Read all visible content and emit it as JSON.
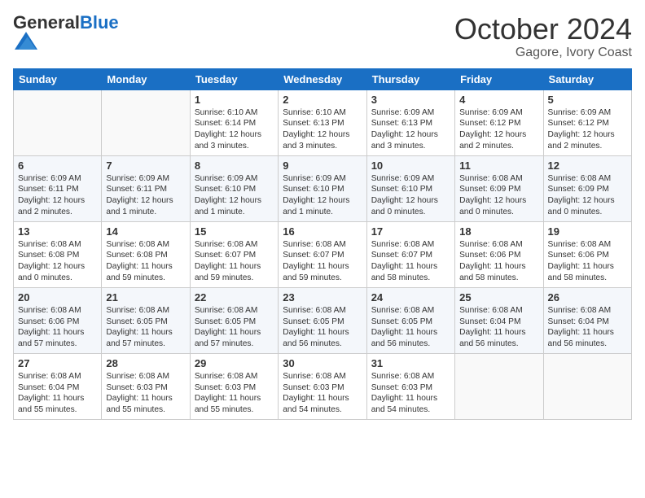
{
  "header": {
    "logo_general": "General",
    "logo_blue": "Blue",
    "month": "October 2024",
    "location": "Gagore, Ivory Coast"
  },
  "weekdays": [
    "Sunday",
    "Monday",
    "Tuesday",
    "Wednesday",
    "Thursday",
    "Friday",
    "Saturday"
  ],
  "weeks": [
    [
      {
        "day": "",
        "text": ""
      },
      {
        "day": "",
        "text": ""
      },
      {
        "day": "1",
        "text": "Sunrise: 6:10 AM\nSunset: 6:14 PM\nDaylight: 12 hours and 3 minutes."
      },
      {
        "day": "2",
        "text": "Sunrise: 6:10 AM\nSunset: 6:13 PM\nDaylight: 12 hours and 3 minutes."
      },
      {
        "day": "3",
        "text": "Sunrise: 6:09 AM\nSunset: 6:13 PM\nDaylight: 12 hours and 3 minutes."
      },
      {
        "day": "4",
        "text": "Sunrise: 6:09 AM\nSunset: 6:12 PM\nDaylight: 12 hours and 2 minutes."
      },
      {
        "day": "5",
        "text": "Sunrise: 6:09 AM\nSunset: 6:12 PM\nDaylight: 12 hours and 2 minutes."
      }
    ],
    [
      {
        "day": "6",
        "text": "Sunrise: 6:09 AM\nSunset: 6:11 PM\nDaylight: 12 hours and 2 minutes."
      },
      {
        "day": "7",
        "text": "Sunrise: 6:09 AM\nSunset: 6:11 PM\nDaylight: 12 hours and 1 minute."
      },
      {
        "day": "8",
        "text": "Sunrise: 6:09 AM\nSunset: 6:10 PM\nDaylight: 12 hours and 1 minute."
      },
      {
        "day": "9",
        "text": "Sunrise: 6:09 AM\nSunset: 6:10 PM\nDaylight: 12 hours and 1 minute."
      },
      {
        "day": "10",
        "text": "Sunrise: 6:09 AM\nSunset: 6:10 PM\nDaylight: 12 hours and 0 minutes."
      },
      {
        "day": "11",
        "text": "Sunrise: 6:08 AM\nSunset: 6:09 PM\nDaylight: 12 hours and 0 minutes."
      },
      {
        "day": "12",
        "text": "Sunrise: 6:08 AM\nSunset: 6:09 PM\nDaylight: 12 hours and 0 minutes."
      }
    ],
    [
      {
        "day": "13",
        "text": "Sunrise: 6:08 AM\nSunset: 6:08 PM\nDaylight: 12 hours and 0 minutes."
      },
      {
        "day": "14",
        "text": "Sunrise: 6:08 AM\nSunset: 6:08 PM\nDaylight: 11 hours and 59 minutes."
      },
      {
        "day": "15",
        "text": "Sunrise: 6:08 AM\nSunset: 6:07 PM\nDaylight: 11 hours and 59 minutes."
      },
      {
        "day": "16",
        "text": "Sunrise: 6:08 AM\nSunset: 6:07 PM\nDaylight: 11 hours and 59 minutes."
      },
      {
        "day": "17",
        "text": "Sunrise: 6:08 AM\nSunset: 6:07 PM\nDaylight: 11 hours and 58 minutes."
      },
      {
        "day": "18",
        "text": "Sunrise: 6:08 AM\nSunset: 6:06 PM\nDaylight: 11 hours and 58 minutes."
      },
      {
        "day": "19",
        "text": "Sunrise: 6:08 AM\nSunset: 6:06 PM\nDaylight: 11 hours and 58 minutes."
      }
    ],
    [
      {
        "day": "20",
        "text": "Sunrise: 6:08 AM\nSunset: 6:06 PM\nDaylight: 11 hours and 57 minutes."
      },
      {
        "day": "21",
        "text": "Sunrise: 6:08 AM\nSunset: 6:05 PM\nDaylight: 11 hours and 57 minutes."
      },
      {
        "day": "22",
        "text": "Sunrise: 6:08 AM\nSunset: 6:05 PM\nDaylight: 11 hours and 57 minutes."
      },
      {
        "day": "23",
        "text": "Sunrise: 6:08 AM\nSunset: 6:05 PM\nDaylight: 11 hours and 56 minutes."
      },
      {
        "day": "24",
        "text": "Sunrise: 6:08 AM\nSunset: 6:05 PM\nDaylight: 11 hours and 56 minutes."
      },
      {
        "day": "25",
        "text": "Sunrise: 6:08 AM\nSunset: 6:04 PM\nDaylight: 11 hours and 56 minutes."
      },
      {
        "day": "26",
        "text": "Sunrise: 6:08 AM\nSunset: 6:04 PM\nDaylight: 11 hours and 56 minutes."
      }
    ],
    [
      {
        "day": "27",
        "text": "Sunrise: 6:08 AM\nSunset: 6:04 PM\nDaylight: 11 hours and 55 minutes."
      },
      {
        "day": "28",
        "text": "Sunrise: 6:08 AM\nSunset: 6:03 PM\nDaylight: 11 hours and 55 minutes."
      },
      {
        "day": "29",
        "text": "Sunrise: 6:08 AM\nSunset: 6:03 PM\nDaylight: 11 hours and 55 minutes."
      },
      {
        "day": "30",
        "text": "Sunrise: 6:08 AM\nSunset: 6:03 PM\nDaylight: 11 hours and 54 minutes."
      },
      {
        "day": "31",
        "text": "Sunrise: 6:08 AM\nSunset: 6:03 PM\nDaylight: 11 hours and 54 minutes."
      },
      {
        "day": "",
        "text": ""
      },
      {
        "day": "",
        "text": ""
      }
    ]
  ]
}
